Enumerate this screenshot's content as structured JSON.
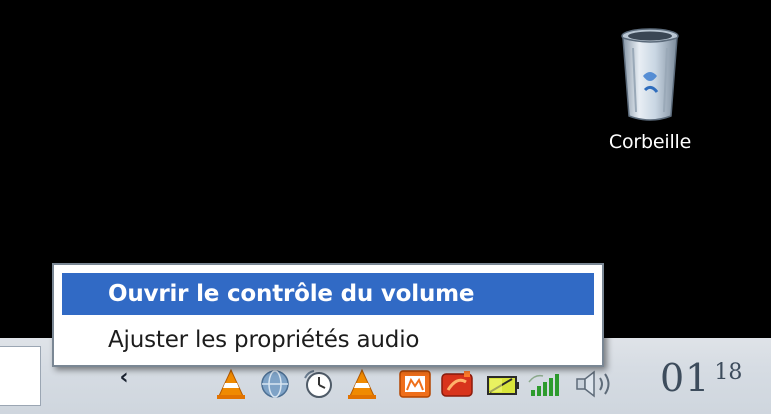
{
  "desktop": {
    "background": "#000000",
    "recycle_bin": {
      "label": "Corbeille",
      "icon": "recycle-bin-icon"
    }
  },
  "context_menu": {
    "items": [
      {
        "label": "Ouvrir le contrôle du volume",
        "default": true,
        "highlighted": true
      },
      {
        "label": "Ajuster les propriétés audio",
        "default": false,
        "highlighted": false
      }
    ],
    "highlight_color": "#316ac5"
  },
  "taskbar": {
    "tray_icons": [
      "show-hidden-icons-chevron",
      "vlc-cone-icon",
      "network-globe-icon",
      "clock-app-icon",
      "vlc-cone-icon",
      "messenger-icon",
      "red-app-icon",
      "battery-power-icon",
      "wifi-signal-icon",
      "volume-speaker-icon"
    ],
    "clock": {
      "hours": "01",
      "minutes": "18"
    }
  }
}
